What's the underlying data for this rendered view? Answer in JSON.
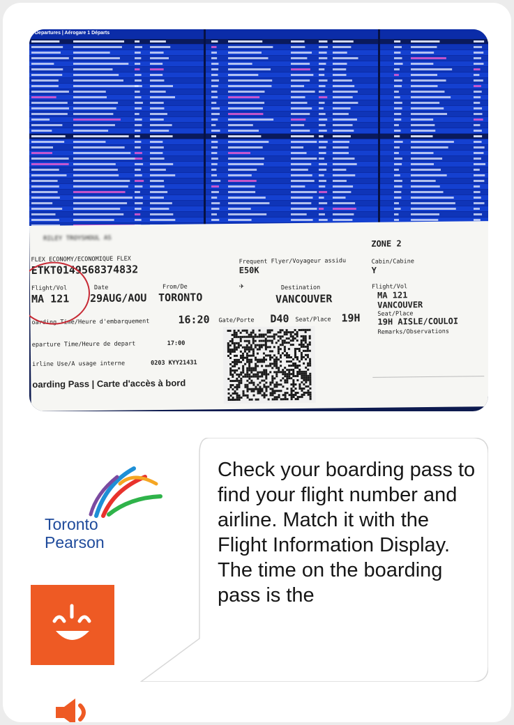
{
  "photo": {
    "fids_title": "Departures | Aérogare 1 Départs",
    "pass": {
      "name": "RILEY TROYSHOUL AS",
      "fare": "FLEX ECONOMY/ECONOMIQUE FLEX",
      "etkt": "ETKT0149568374832",
      "ffp_label": "Frequent Flyer/Voyageur assidu",
      "ffp_value": "E50K",
      "zone": "ZONE 2",
      "cabin_label": "Cabin/Cabine",
      "cabin_value": "Y",
      "flight_label": "Flight/Vol",
      "flight_value": "MA 121",
      "date_label": "Date",
      "date_value": "29AUG/AOU",
      "from_label": "From/De",
      "from_value": "TORONTO",
      "dest_label": "Destination",
      "dest_value": "VANCOUVER",
      "stub_flight_label": "Flight/Vol",
      "stub_flight_value": "MA 121",
      "stub_dest_value": "VANCOUVER",
      "stub_seat_label": "Seat/Place",
      "stub_seat_value": "19H AISLE/COULOI",
      "remarks_label": "Remarks/Observations",
      "boarding_label": "oarding Time/Heure d'embarquement",
      "boarding_value": "16:20",
      "gate_label": "Gate/Porte",
      "gate_value": "D40",
      "seat_label": "Seat/Place",
      "seat_value": "19H",
      "departure_label": "eparture Time/Heure de depart",
      "departure_value": "17:00",
      "airline_use_label": "irline Use/A usage interne",
      "airline_use_value": "0203 KYY21431",
      "pass_title": "oarding Pass | Carte d'accès à bord"
    }
  },
  "logo": {
    "line1": "Toronto",
    "line2": "Pearson",
    "colors": [
      "#1e8fd6",
      "#e8322c",
      "#f5a623",
      "#2fb34a",
      "#7b4aa0"
    ]
  },
  "app_icon": {
    "name": "smiley-app-icon",
    "color": "#ee5a24"
  },
  "message": "Check your boarding pass to find your flight number and airline. Match it with the Flight Information Display. The time on the boarding pass is the",
  "speaker_icon": {
    "name": "speaker-icon",
    "color": "#ee5a24"
  }
}
